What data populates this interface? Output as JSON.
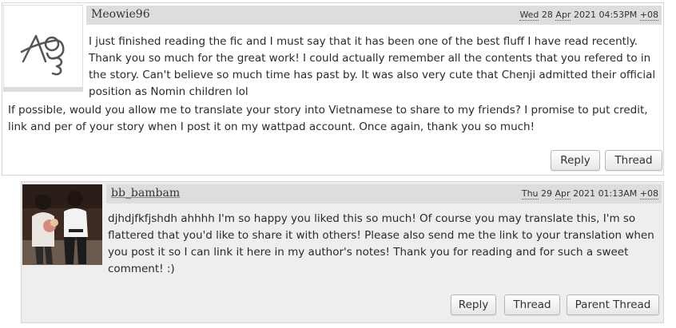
{
  "comments": [
    {
      "username": "Meowie96",
      "date": {
        "weekday": "Wed",
        "day": "28",
        "month": "Apr",
        "year": "2021",
        "time": "04:53PM",
        "tz": "+08"
      },
      "avatar_icon": "ao3-logo-icon",
      "paragraphs": [
        "I just finished reading the fic and I must say that it has been one of the best fluff I have read recently. Thank you so much for the great work! I could actually remember all the contents that you refered to in the story. Can't believe so much time has past by. It was also very cute that Chenji admitted their official position as Nomin children lol",
        "If possible, would you allow me to translate your story into Vietnamese to share to my friends? I promise to put credit, link and per of your story when I post it on my wattpad account. Once again, thank you so much!"
      ],
      "buttons": {
        "reply": "Reply",
        "thread": "Thread"
      }
    },
    {
      "username": "bb_bambam",
      "date": {
        "weekday": "Thu",
        "day": "29",
        "month": "Apr",
        "year": "2021",
        "time": "01:13AM",
        "tz": "+08"
      },
      "avatar_icon": "user-photo-avatar",
      "paragraphs": [
        "djhdjfkfjshdh ahhhh I'm so happy you liked this so much! Of course you may translate this, I'm so flattered that you'd like to share it with others! Please also send me the link to your translation when you post it so I can link it here in my author's notes! Thank you for reading and for such a sweet comment! :)"
      ],
      "buttons": {
        "reply": "Reply",
        "thread": "Thread",
        "parent_thread": "Parent Thread"
      }
    }
  ]
}
